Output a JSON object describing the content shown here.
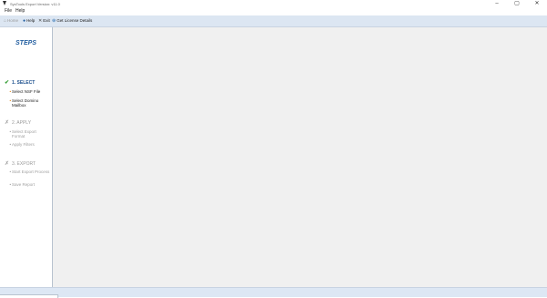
{
  "window": {
    "title": "SysTools Export Version: v11.0",
    "minimize_glyph": "–",
    "maximize_glyph": "▢",
    "close_glyph": "✕"
  },
  "menu": {
    "file": "File",
    "help": "Help"
  },
  "toolbar": {
    "home": "Home",
    "help": "Help",
    "exit": "Exit",
    "license": "Get License Details",
    "icons": {
      "home": "home-icon",
      "help": "help-icon",
      "exit": "exit-icon",
      "license": "license-icon"
    }
  },
  "steps": {
    "title": "STEPS",
    "groups": [
      {
        "label": "1. SELECT",
        "state": "active",
        "marker": "✔",
        "items": [
          "Select NSF File",
          "Select Domino Mailbox"
        ]
      },
      {
        "label": "2. APPLY",
        "state": "inactive",
        "marker": "✗",
        "items": [
          "Select Export Format",
          "Apply Filters"
        ]
      },
      {
        "label": "3. EXPORT",
        "state": "inactive",
        "marker": "✗",
        "items": [
          "Start Export Process",
          "Save Report"
        ]
      }
    ]
  },
  "colors": {
    "accent": "#1f5c9e",
    "check": "#2e9a2e",
    "bullet": "#e08a1e",
    "toolbar_bg": "#dce6f2",
    "content_bg": "#f0f0f0"
  }
}
